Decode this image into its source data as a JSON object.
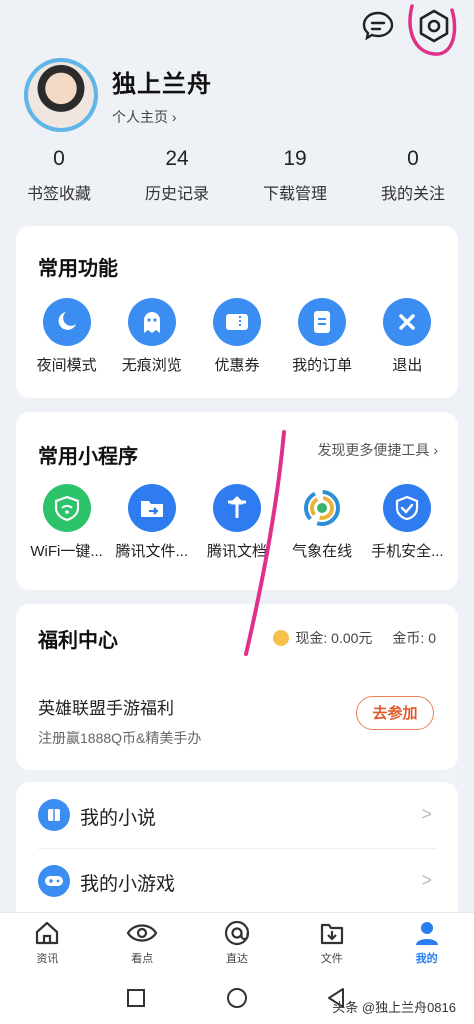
{
  "profile": {
    "username": "独上兰舟",
    "homepage_link": "个人主页 ›"
  },
  "stats": [
    {
      "count": "0",
      "label": "书签收藏"
    },
    {
      "count": "24",
      "label": "历史记录"
    },
    {
      "count": "19",
      "label": "下载管理"
    },
    {
      "count": "0",
      "label": "我的关注"
    }
  ],
  "common_functions": {
    "title": "常用功能",
    "items": [
      {
        "label": "夜间模式",
        "icon": "night-mode-icon"
      },
      {
        "label": "无痕浏览",
        "icon": "ghost-icon"
      },
      {
        "label": "优惠券",
        "icon": "coupon-icon"
      },
      {
        "label": "我的订单",
        "icon": "order-icon"
      },
      {
        "label": "退出",
        "icon": "exit-icon"
      }
    ]
  },
  "mini_programs": {
    "title": "常用小程序",
    "more_link": "发现更多便捷工具 ›",
    "items": [
      {
        "label": "WiFi一键...",
        "icon": "wifi-shield-icon"
      },
      {
        "label": "腾讯文件...",
        "icon": "tencent-files-icon"
      },
      {
        "label": "腾讯文档",
        "icon": "tencent-docs-icon"
      },
      {
        "label": "气象在线",
        "icon": "weather-icon"
      },
      {
        "label": "手机安全...",
        "icon": "phone-security-icon"
      }
    ]
  },
  "welfare": {
    "title": "福利中心",
    "cash": "现金: 0.00元",
    "coins": "金币: 0",
    "game_title": "英雄联盟手游福利",
    "game_sub": "注册赢1888Q币&精美手办",
    "join_button": "去参加"
  },
  "list": [
    {
      "label": "我的小说",
      "icon": "novel-icon"
    },
    {
      "label": "我的小游戏",
      "icon": "gamepad-icon"
    }
  ],
  "tabs": [
    {
      "label": "资讯",
      "icon": "home-icon"
    },
    {
      "label": "看点",
      "icon": "eye-icon"
    },
    {
      "label": "直达",
      "icon": "at-icon"
    },
    {
      "label": "文件",
      "icon": "download-file-icon"
    },
    {
      "label": "我的",
      "icon": "user-icon",
      "active": true
    }
  ],
  "watermark": "头条 @独上兰舟0816",
  "colors": {
    "accent": "#2b7ef2",
    "icon_blue": "#3b8df2",
    "green": "#2cc36b",
    "orange": "#e2592c",
    "annotation": "#e0318a"
  }
}
